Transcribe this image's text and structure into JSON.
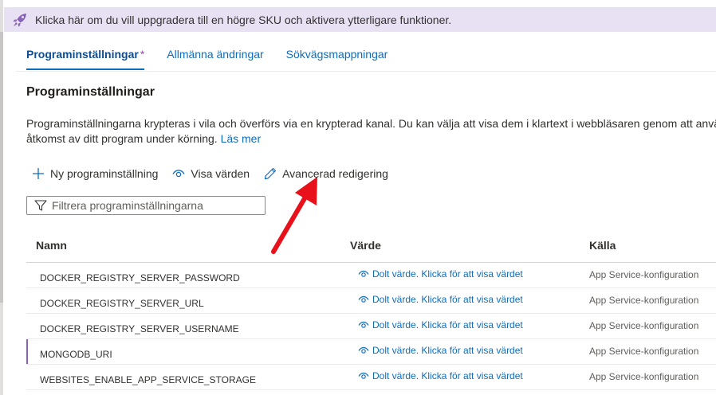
{
  "banner": {
    "icon": "rocket-icon",
    "text": "Klicka här om du vill uppgradera till en högre SKU och aktivera ytterligare funktioner."
  },
  "tabs": [
    {
      "label": "Programinställningar",
      "active": true,
      "modified_marker": "*"
    },
    {
      "label": "Allmänna ändringar"
    },
    {
      "label": "Sökvägsmappningar"
    }
  ],
  "page": {
    "title": "Programinställningar",
    "description": "Programinställningarna krypteras i vila och överförs via en krypterad kanal. Du kan välja att visa dem i klartext i webbläsaren genom att använda kontrollerna nedan. Programinställningarna exponeras som miljövariabler för åtkomst av ditt program under körning.",
    "description_line1": "Programinställningarna krypteras i vila och överförs via en krypterad kanal. Du kan välja att visa dem i klartext i webbläsaren genom att använda",
    "description_line2": "åtkomst av ditt program under körning.",
    "learn_more": "Läs mer"
  },
  "toolbar": {
    "new_setting": "Ny programinställning",
    "show_values": "Visa värden",
    "advanced_edit": "Avancerad redigering"
  },
  "filter": {
    "placeholder": "Filtrera programinställningarna"
  },
  "table": {
    "headers": {
      "name": "Namn",
      "value": "Värde",
      "source": "Källa"
    },
    "rows": [
      {
        "name": "DOCKER_REGISTRY_SERVER_PASSWORD",
        "value": "Dolt värde. Klicka för att visa värdet",
        "source": "App Service-konfiguration"
      },
      {
        "name": "DOCKER_REGISTRY_SERVER_URL",
        "value": "Dolt värde. Klicka för att visa värdet",
        "source": "App Service-konfiguration"
      },
      {
        "name": "DOCKER_REGISTRY_SERVER_USERNAME",
        "value": "Dolt värde. Klicka för att visa värdet",
        "source": "App Service-konfiguration"
      },
      {
        "name": "MONGODB_URI",
        "value": "Dolt värde. Klicka för att visa värdet",
        "source": "App Service-konfiguration"
      },
      {
        "name": "WEBSITES_ENABLE_APP_SERVICE_STORAGE",
        "value": "Dolt värde. Klicka för att visa värdet",
        "source": "App Service-konfiguration"
      }
    ]
  },
  "colors": {
    "accent": "#0f6cbd",
    "banner_bg": "#e8e1f3",
    "annotation_arrow": "#e8111b"
  }
}
